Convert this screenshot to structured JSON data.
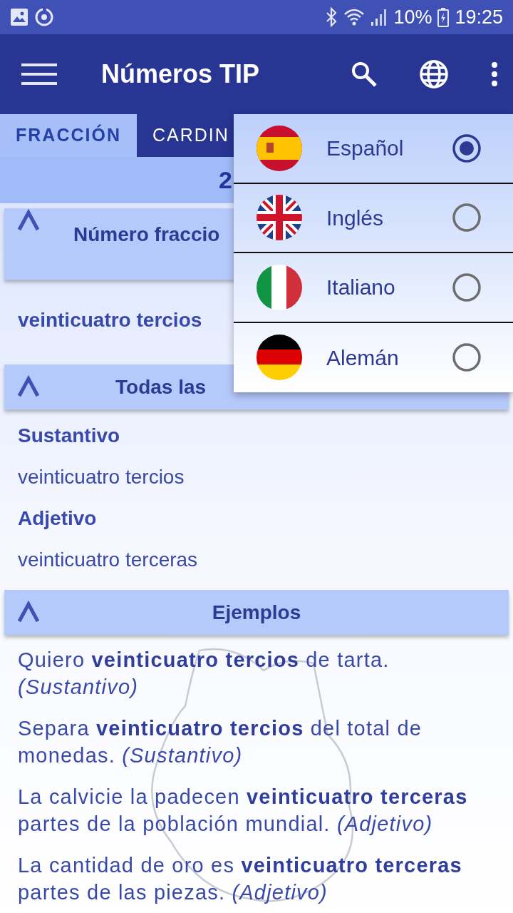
{
  "status_bar": {
    "battery": "10%",
    "time": "19:25"
  },
  "app_bar": {
    "title": "Números TIP"
  },
  "tabs": [
    {
      "label": "FRACCIÓN",
      "selected": true
    },
    {
      "label": "CARDIN",
      "selected": false
    }
  ],
  "number": "2",
  "sections": [
    {
      "title": "Número fraccio",
      "expanded": true,
      "tall": true,
      "items": [
        {
          "kind": "answer",
          "text": "veinticuatro tercios"
        }
      ]
    },
    {
      "title": "Todas las",
      "expanded": true,
      "items": [
        {
          "kind": "label",
          "text": "Sustantivo"
        },
        {
          "kind": "form",
          "text": "veinticuatro tercios"
        },
        {
          "kind": "label",
          "text": "Adjetivo"
        },
        {
          "kind": "form",
          "text": "veinticuatro terceras"
        }
      ]
    },
    {
      "title": "Ejemplos",
      "expanded": true,
      "items": [
        {
          "kind": "example",
          "text": "Quiero **veinticuatro tercios** de tarta. *(Sustantivo)*"
        },
        {
          "kind": "example",
          "text": "Separa **veinticuatro tercios** del total de monedas. *(Sustantivo)*"
        },
        {
          "kind": "example",
          "text": "La calvicie la padecen **veinticuatro terceras** partes de la población mundial. *(Adjetivo)*"
        },
        {
          "kind": "example",
          "text": "La cantidad de oro es **veinticuatro terceras** partes de las piezas. *(Adjetivo)*"
        }
      ]
    }
  ],
  "language_menu": [
    {
      "label": "Español",
      "kind": "spain",
      "selected": true
    },
    {
      "label": "Inglés",
      "kind": "uk",
      "selected": false
    },
    {
      "label": "Italiano",
      "kind": "italy",
      "selected": false
    },
    {
      "label": "Alemán",
      "kind": "germany",
      "selected": false
    }
  ]
}
